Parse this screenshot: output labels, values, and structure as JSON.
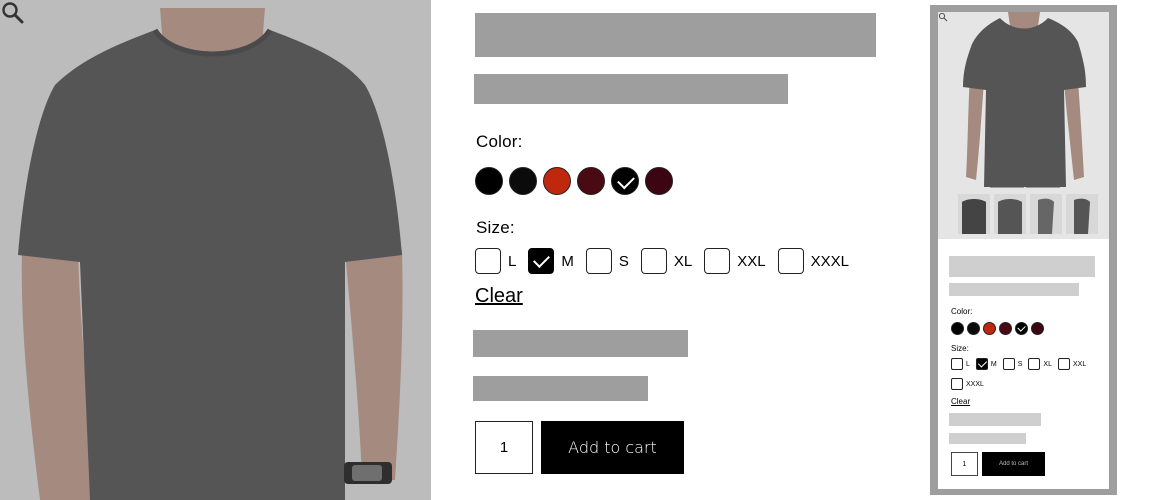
{
  "product": {
    "image_alt": "Dark heather grey crew-neck t-shirt worn by model",
    "zoom_icon": "magnifier-icon"
  },
  "options": {
    "color_label": "Color:",
    "colors": [
      {
        "name": "black",
        "hex": "#000000",
        "selected": false
      },
      {
        "name": "black-2",
        "hex": "#0b0b0b",
        "selected": false
      },
      {
        "name": "orange-red",
        "hex": "#c0280d",
        "selected": false
      },
      {
        "name": "maroon",
        "hex": "#4a0a13",
        "selected": false
      },
      {
        "name": "black-selected",
        "hex": "#000000",
        "selected": true
      },
      {
        "name": "burgundy",
        "hex": "#3b0611",
        "selected": false
      }
    ],
    "size_label": "Size:",
    "sizes": [
      {
        "label": "L",
        "checked": false
      },
      {
        "label": "M",
        "checked": true
      },
      {
        "label": "S",
        "checked": false
      },
      {
        "label": "XL",
        "checked": false
      },
      {
        "label": "XXL",
        "checked": false
      },
      {
        "label": "XXXL",
        "checked": false
      }
    ],
    "clear_label": "Clear"
  },
  "cart": {
    "quantity": "1",
    "add_label": "Add to cart"
  },
  "preview": {
    "color_label": "Color:",
    "size_label": "Size:",
    "clear_label": "Clear",
    "quantity": "1",
    "add_label": "Add to cart"
  },
  "colors": {
    "placeholder": "#9e9e9e",
    "button_bg": "#000000"
  }
}
